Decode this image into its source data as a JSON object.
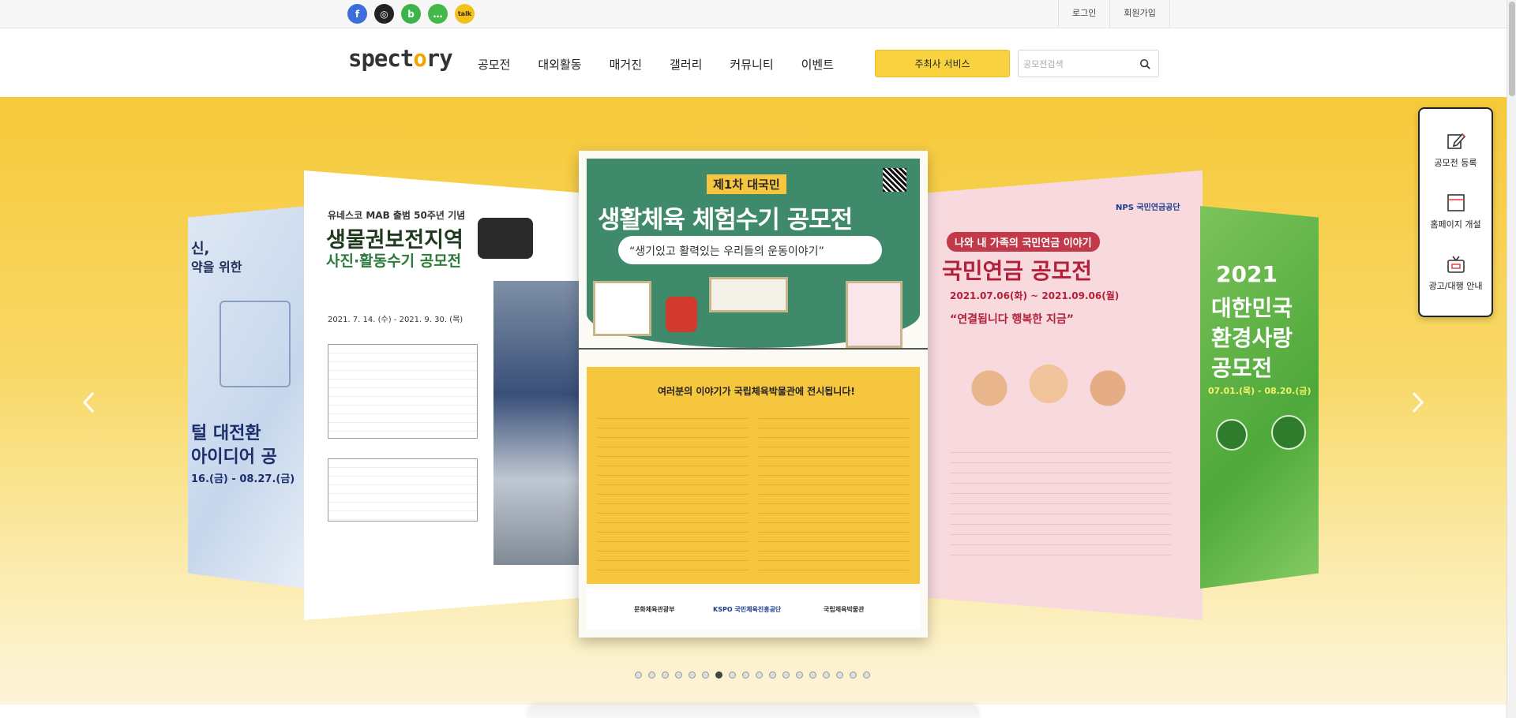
{
  "social_links": [
    {
      "name": "facebook-icon",
      "glyph": "f",
      "color": "#3b6ed8"
    },
    {
      "name": "instagram-icon",
      "glyph": "◎",
      "color": "#222222"
    },
    {
      "name": "naver-blog-icon",
      "glyph": "b",
      "color": "#3cb44a"
    },
    {
      "name": "naver-band-icon",
      "glyph": "…",
      "color": "#44b84a"
    },
    {
      "name": "kakao-icon",
      "glyph": "talk",
      "color": "#f3c21a"
    }
  ],
  "top_links": {
    "login": "로그인",
    "signup": "회원가입"
  },
  "logo": {
    "before": "spect",
    "o": "o",
    "after": "ry"
  },
  "nav": [
    "공모전",
    "대외활동",
    "매거진",
    "갤러리",
    "커뮤니티",
    "이벤트"
  ],
  "cta_label": "주최사 서비스",
  "search": {
    "placeholder": "공모전검색",
    "value": ""
  },
  "posters": {
    "far_left": {
      "line1": "신,",
      "line2": "약을 위한",
      "big1": "털 대전환",
      "big2": "아이디어 공",
      "date": "16.(금) - 08.27.(금)"
    },
    "left": {
      "kicker": "유네스코 MAB 출범 50주년 기념",
      "title1": "생물권보전지역",
      "title2": "사진·활동수기 공모전",
      "period": "2021. 7. 14. (수) - 2021. 9. 30. (목)"
    },
    "center": {
      "badge": "제1차 대국민",
      "title": "생활체육 체험수기 공모전",
      "tagline": "“생기있고 활력있는 우리들의 운동이야기”",
      "banner": "여러분의 이야기가 국립체육박물관에 전시됩니다!",
      "org1": "문화체육관광부",
      "org2": "KSPO 국민체육진흥공단",
      "org3": "국립체육박물관"
    },
    "right": {
      "kicker": "나와 내 가족의 국민연금 이야기",
      "title": "국민연금 공모전",
      "period": "2021.07.06(화) ~ 2021.09.06(월)",
      "slogan": "“연결됩니다 행복한 지금”",
      "org": "NPS 국민연금공단"
    },
    "far_right": {
      "year": "2021",
      "t1": "대한민국",
      "t2": "환경사랑",
      "t3": "공모전",
      "date": "07.01.(목) - 08.20.(금)"
    }
  },
  "slider": {
    "total_dots": 18,
    "active_index": 6
  },
  "side_panel": [
    {
      "icon": "edit-icon",
      "label": "공모전 등록"
    },
    {
      "icon": "webpage-icon",
      "label": "홈페이지 개설"
    },
    {
      "icon": "tv-icon",
      "label": "광고/대행 안내"
    }
  ]
}
